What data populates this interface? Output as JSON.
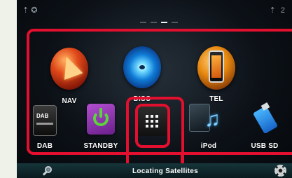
{
  "status_bar": {
    "left_icons": "⇡ ✪",
    "right_icons": "⇡ 2"
  },
  "apps": [
    {
      "id": "nav",
      "label": "NAV",
      "icon": "nav-icon"
    },
    {
      "id": "disc",
      "label": "DISC",
      "icon": "disc-icon"
    },
    {
      "id": "tel",
      "label": "TEL",
      "icon": "phone-icon"
    },
    {
      "id": "dab",
      "label": "DAB",
      "icon": "dab-radio-icon"
    },
    {
      "id": "standby",
      "label": "STANDBY",
      "icon": "power-icon"
    },
    {
      "id": "all_sources",
      "label": "",
      "icon": "grid-icon"
    },
    {
      "id": "ipod",
      "label": "iPod",
      "icon": "ipod-music-icon"
    },
    {
      "id": "usb_sd",
      "label": "USB SD",
      "icon": "usb-icon"
    }
  ],
  "bottom_bar": {
    "status_text": "Locating Satellites",
    "left_icon": "search-icon",
    "right_icon": "gear-icon"
  },
  "colors": {
    "highlight": "#e30f2e",
    "background": "#0c1117",
    "label_text": "#ffffff"
  }
}
